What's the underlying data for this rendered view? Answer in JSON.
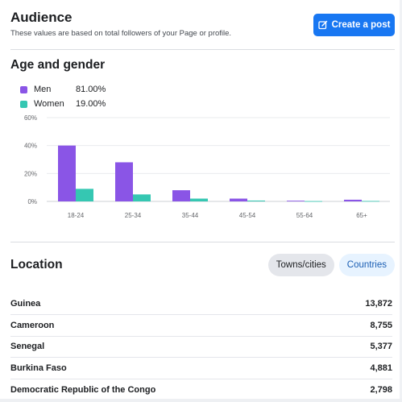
{
  "header": {
    "title": "Audience",
    "subtitle": "These values are based on total followers of your Page or profile.",
    "create_post_label": "Create a post"
  },
  "age_gender": {
    "section_title": "Age and gender",
    "legend": [
      {
        "name": "Men",
        "value": "81.00%",
        "color": "#8a55e6"
      },
      {
        "name": "Women",
        "value": "19.00%",
        "color": "#35c7b2"
      }
    ]
  },
  "chart_data": {
    "type": "bar",
    "categories": [
      "18-24",
      "25-34",
      "35-44",
      "45-54",
      "55-64",
      "65+"
    ],
    "series": [
      {
        "name": "Men",
        "values": [
          40,
          28,
          8,
          2,
          0.5,
          1.2
        ],
        "color": "#8a55e6"
      },
      {
        "name": "Women",
        "values": [
          9,
          5,
          2,
          0.6,
          0.2,
          0.3
        ],
        "color": "#35c7b2"
      }
    ],
    "yticks": [
      "0%",
      "20%",
      "40%",
      "60%"
    ],
    "ylim": [
      0,
      60
    ],
    "grid": true
  },
  "location": {
    "section_title": "Location",
    "tabs": [
      "Towns/cities",
      "Countries"
    ],
    "active_tab": "Countries",
    "rows": [
      {
        "name": "Guinea",
        "value": "13,872"
      },
      {
        "name": "Cameroon",
        "value": "8,755"
      },
      {
        "name": "Senegal",
        "value": "5,377"
      },
      {
        "name": "Burkina Faso",
        "value": "4,881"
      },
      {
        "name": "Democratic Republic of the Congo",
        "value": "2,798"
      }
    ]
  }
}
